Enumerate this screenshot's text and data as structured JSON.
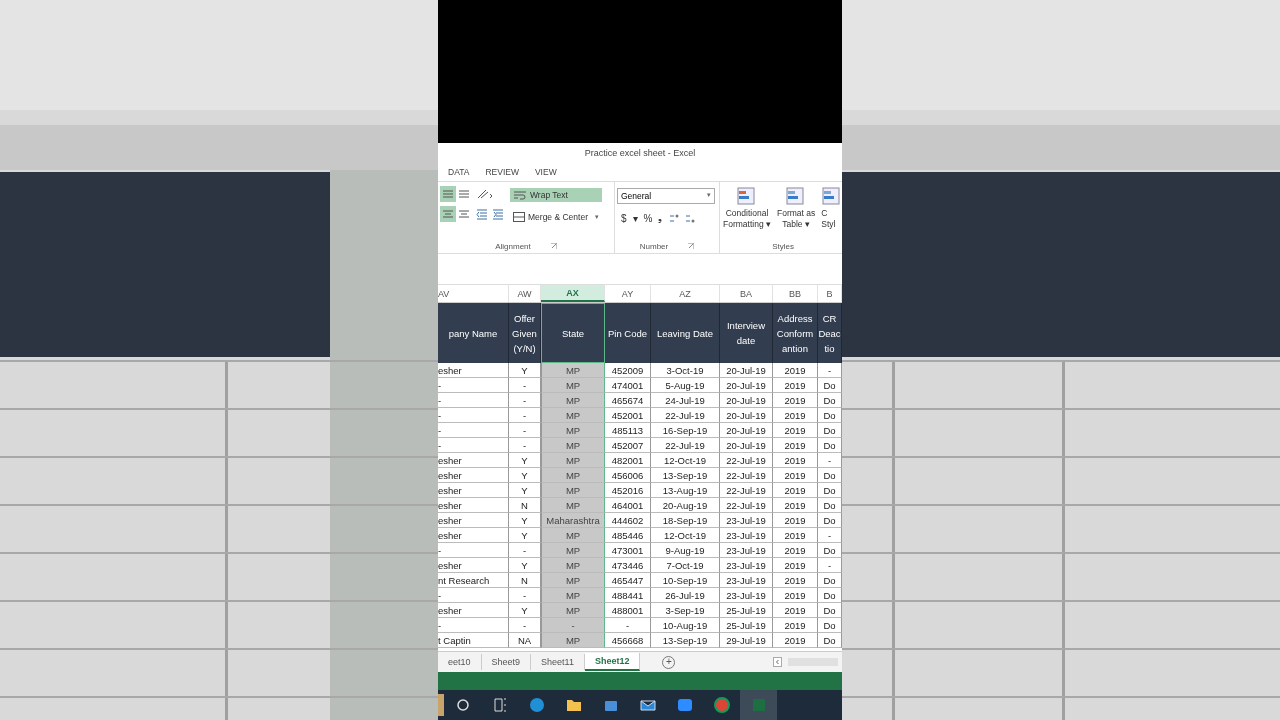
{
  "window": {
    "title": "Practice excel sheet - Excel"
  },
  "ribbon_tabs": [
    {
      "label": "DATA",
      "selected": false
    },
    {
      "label": "REVIEW",
      "selected": false
    },
    {
      "label": "VIEW",
      "selected": false
    }
  ],
  "alignment_buttons": [
    {
      "selected": true
    },
    {
      "selected": false
    },
    {
      "selected": true
    },
    {
      "selected": false
    }
  ],
  "wrap_text": {
    "label": "Wrap Text",
    "on": true
  },
  "merge_center": {
    "label": "Merge & Center",
    "caret": "▾"
  },
  "number_format": {
    "value": "General",
    "caret": "▾"
  },
  "number_buttons": [
    "$",
    "▾",
    "%",
    "❟"
  ],
  "styles_buttons": [
    {
      "lines": [
        "Conditional",
        "Formatting ▾"
      ]
    },
    {
      "lines": [
        "Format as",
        "Table ▾"
      ]
    },
    {
      "lines": [
        "C",
        "Styl"
      ]
    }
  ],
  "groups": [
    "Alignment",
    "Number",
    "Styles"
  ],
  "column_letters": [
    {
      "label": "AV",
      "selected": false
    },
    {
      "label": "AW",
      "selected": false
    },
    {
      "label": "AX",
      "selected": true
    },
    {
      "label": "AY",
      "selected": false
    },
    {
      "label": "AZ",
      "selected": false
    },
    {
      "label": "BA",
      "selected": false
    },
    {
      "label": "BB",
      "selected": false
    },
    {
      "label": "B",
      "selected": false
    }
  ],
  "table": {
    "columns": [
      {
        "lines": [
          "pany Name"
        ],
        "selected": false
      },
      {
        "lines": [
          "Offer",
          "Given",
          "(Y/N)"
        ],
        "selected": false
      },
      {
        "lines": [
          "State"
        ],
        "selected": true
      },
      {
        "lines": [
          "Pin Code"
        ],
        "selected": false
      },
      {
        "lines": [
          "Leaving Date"
        ],
        "selected": false
      },
      {
        "lines": [
          "Interview",
          "date"
        ],
        "selected": false
      },
      {
        "lines": [
          "Address",
          "Conform",
          "antion"
        ],
        "selected": false
      },
      {
        "lines": [
          "CR",
          "Deac",
          "tio"
        ],
        "selected": false
      }
    ],
    "rows": [
      [
        "esher",
        "Y",
        "MP",
        "452009",
        "3-Oct-19",
        "20-Jul-19",
        "2019",
        "-"
      ],
      [
        "-",
        "-",
        "MP",
        "474001",
        "5-Aug-19",
        "20-Jul-19",
        "2019",
        "Do"
      ],
      [
        "-",
        "-",
        "MP",
        "465674",
        "24-Jul-19",
        "20-Jul-19",
        "2019",
        "Do"
      ],
      [
        "-",
        "-",
        "MP",
        "452001",
        "22-Jul-19",
        "20-Jul-19",
        "2019",
        "Do"
      ],
      [
        "-",
        "-",
        "MP",
        "485113",
        "16-Sep-19",
        "20-Jul-19",
        "2019",
        "Do"
      ],
      [
        "-",
        "-",
        "MP",
        "452007",
        "22-Jul-19",
        "20-Jul-19",
        "2019",
        "Do"
      ],
      [
        "esher",
        "Y",
        "MP",
        "482001",
        "12-Oct-19",
        "22-Jul-19",
        "2019",
        "-"
      ],
      [
        "esher",
        "Y",
        "MP",
        "456006",
        "13-Sep-19",
        "22-Jul-19",
        "2019",
        "Do"
      ],
      [
        "esher",
        "Y",
        "MP",
        "452016",
        "13-Aug-19",
        "22-Jul-19",
        "2019",
        "Do"
      ],
      [
        "esher",
        "N",
        "MP",
        "464001",
        "20-Aug-19",
        "22-Jul-19",
        "2019",
        "Do"
      ],
      [
        "esher",
        "Y",
        "Maharashtra",
        "444602",
        "18-Sep-19",
        "23-Jul-19",
        "2019",
        "Do"
      ],
      [
        "esher",
        "Y",
        "MP",
        "485446",
        "12-Oct-19",
        "23-Jul-19",
        "2019",
        "-"
      ],
      [
        "-",
        "-",
        "MP",
        "473001",
        "9-Aug-19",
        "23-Jul-19",
        "2019",
        "Do"
      ],
      [
        "esher",
        "Y",
        "MP",
        "473446",
        "7-Oct-19",
        "23-Jul-19",
        "2019",
        "-"
      ],
      [
        "nt Research",
        "N",
        "MP",
        "465447",
        "10-Sep-19",
        "23-Jul-19",
        "2019",
        "Do"
      ],
      [
        "-",
        "-",
        "MP",
        "488441",
        "26-Jul-19",
        "23-Jul-19",
        "2019",
        "Do"
      ],
      [
        "esher",
        "Y",
        "MP",
        "488001",
        "3-Sep-19",
        "25-Jul-19",
        "2019",
        "Do"
      ],
      [
        "-",
        "-",
        "-",
        "-",
        "10-Aug-19",
        "25-Jul-19",
        "2019",
        "Do"
      ],
      [
        "t Captin",
        "NA",
        "MP",
        "456668",
        "13-Sep-19",
        "29-Jul-19",
        "2019",
        "Do"
      ]
    ]
  },
  "sheet_tabs": [
    {
      "label": "eet10",
      "selected": false
    },
    {
      "label": "Sheet9",
      "selected": false
    },
    {
      "label": "Sheet11",
      "selected": false
    },
    {
      "label": "Sheet12",
      "selected": true
    }
  ],
  "add_sheet": "+",
  "taskbar": [
    {
      "kind": "search",
      "active": false
    },
    {
      "kind": "taskview",
      "active": false
    },
    {
      "kind": "edge",
      "active": false
    },
    {
      "kind": "folder",
      "active": false
    },
    {
      "kind": "store",
      "active": false
    },
    {
      "kind": "mail",
      "active": false
    },
    {
      "kind": "video",
      "active": false
    },
    {
      "kind": "chrome",
      "active": false
    },
    {
      "kind": "excel",
      "active": true
    }
  ]
}
